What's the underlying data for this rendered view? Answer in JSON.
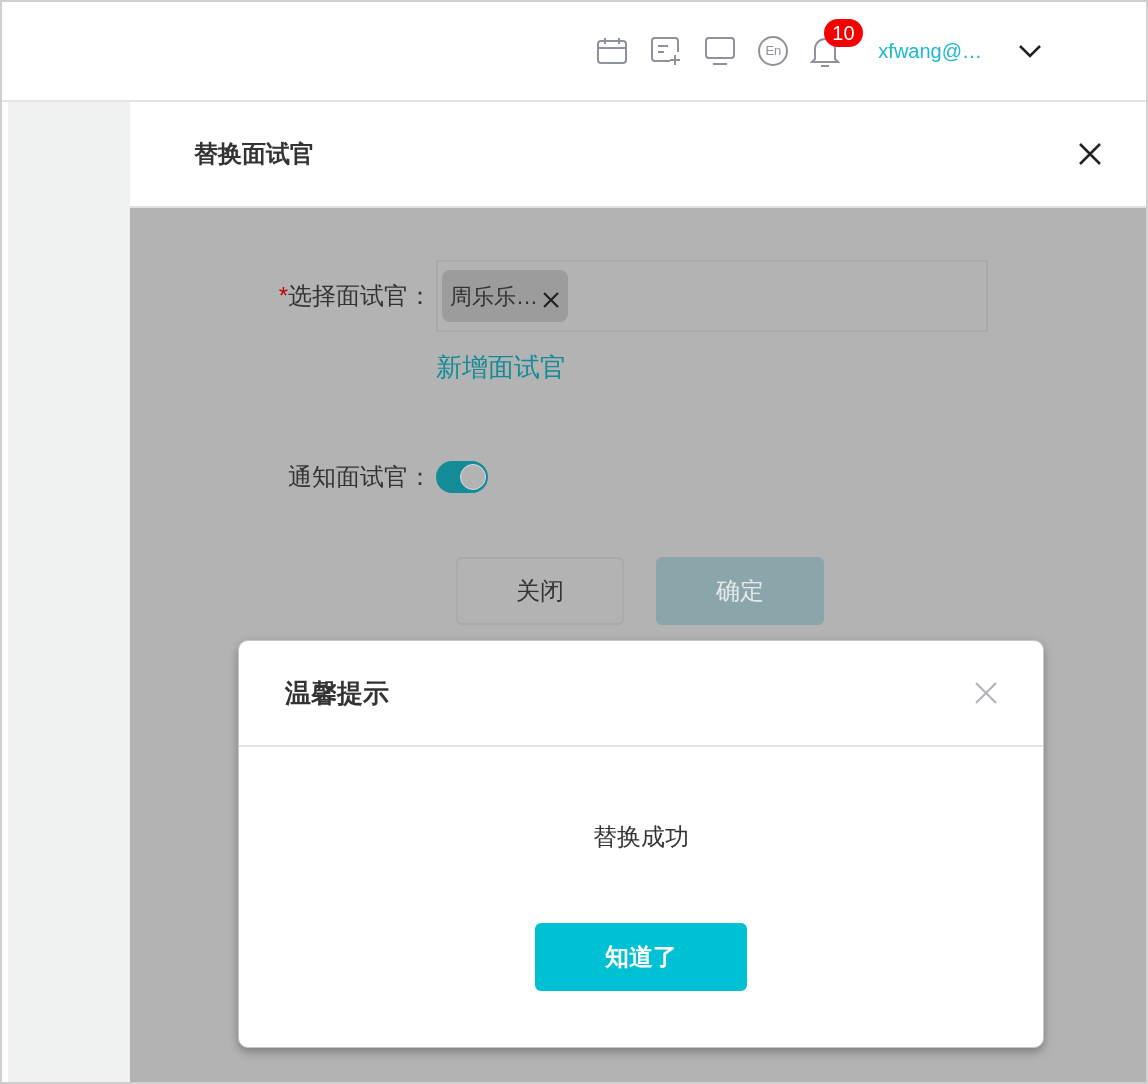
{
  "header": {
    "language": "En",
    "notification_count": "10",
    "user": "xfwang@…"
  },
  "drawer": {
    "title": "替换面试官",
    "fields": [
      {
        "kind": "select",
        "required_mark": "*",
        "label": "选择面试官：",
        "tags": [
          "周乐乐…"
        ],
        "link": "新增面试官"
      },
      {
        "kind": "toggle",
        "label": "通知面试官：",
        "on": true
      }
    ],
    "buttons": [
      {
        "label": "关闭",
        "primary": false,
        "disabled": false
      },
      {
        "label": "确定",
        "primary": true,
        "disabled": true
      }
    ]
  },
  "dialog": {
    "title": "温馨提示",
    "message": "替换成功",
    "button": "知道了"
  }
}
